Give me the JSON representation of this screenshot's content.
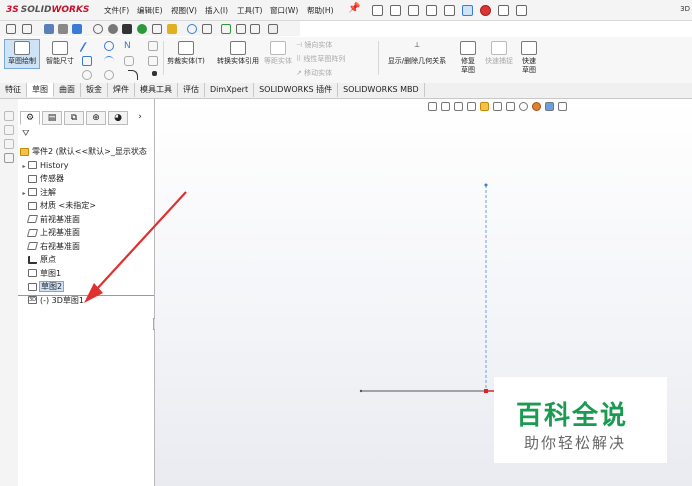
{
  "app": {
    "logo_ds": "3S",
    "logo_solid": "SOLID",
    "logo_works": "WORKS",
    "corner_text": "3D"
  },
  "menu": [
    "文件(F)",
    "编辑(E)",
    "视图(V)",
    "插入(I)",
    "工具(T)",
    "窗口(W)",
    "帮助(H)"
  ],
  "command_manager": {
    "sketch_draw": "草图绘制",
    "smart_dim": "智能尺寸",
    "trim": "剪裁实体(T)",
    "convert": "转换实体引用",
    "offset": "等距实体",
    "mirror": "镜向实体",
    "linear_pattern": "线性草图阵列",
    "move": "移动实体",
    "show_delete_relations": "显示/删除几何关系",
    "repair_sketch": "修复草图",
    "quick_snap": "快速捕捉",
    "rapid_sketch": "快速草图"
  },
  "tabs": [
    "特征",
    "草图",
    "曲面",
    "钣金",
    "焊件",
    "模具工具",
    "评估",
    "DimXpert",
    "SOLIDWORKS 插件",
    "SOLIDWORKS MBD"
  ],
  "active_tab": "草图",
  "tree": {
    "root": "零件2 (默认<<默认>_显示状态",
    "items": [
      {
        "label": "History",
        "expandable": true
      },
      {
        "label": "传感器",
        "expandable": false
      },
      {
        "label": "注解",
        "expandable": true
      },
      {
        "label": "材质 <未指定>",
        "expandable": false
      },
      {
        "label": "前视基准面",
        "expandable": false
      },
      {
        "label": "上视基准面",
        "expandable": false
      },
      {
        "label": "右视基准面",
        "expandable": false
      },
      {
        "label": "原点",
        "expandable": false
      },
      {
        "label": "草图1",
        "expandable": false
      },
      {
        "label": "草图2",
        "expandable": false
      },
      {
        "label": "(-) 3D草图1",
        "expandable": false
      }
    ]
  },
  "watermark": {
    "title": "百科全说",
    "subtitle": "助你轻松解决"
  },
  "colors": {
    "selection": "#cfe3f7",
    "arrow": "#e03030",
    "watermark_green": "#1a9b52",
    "dashed_line": "#6aa0e0"
  }
}
